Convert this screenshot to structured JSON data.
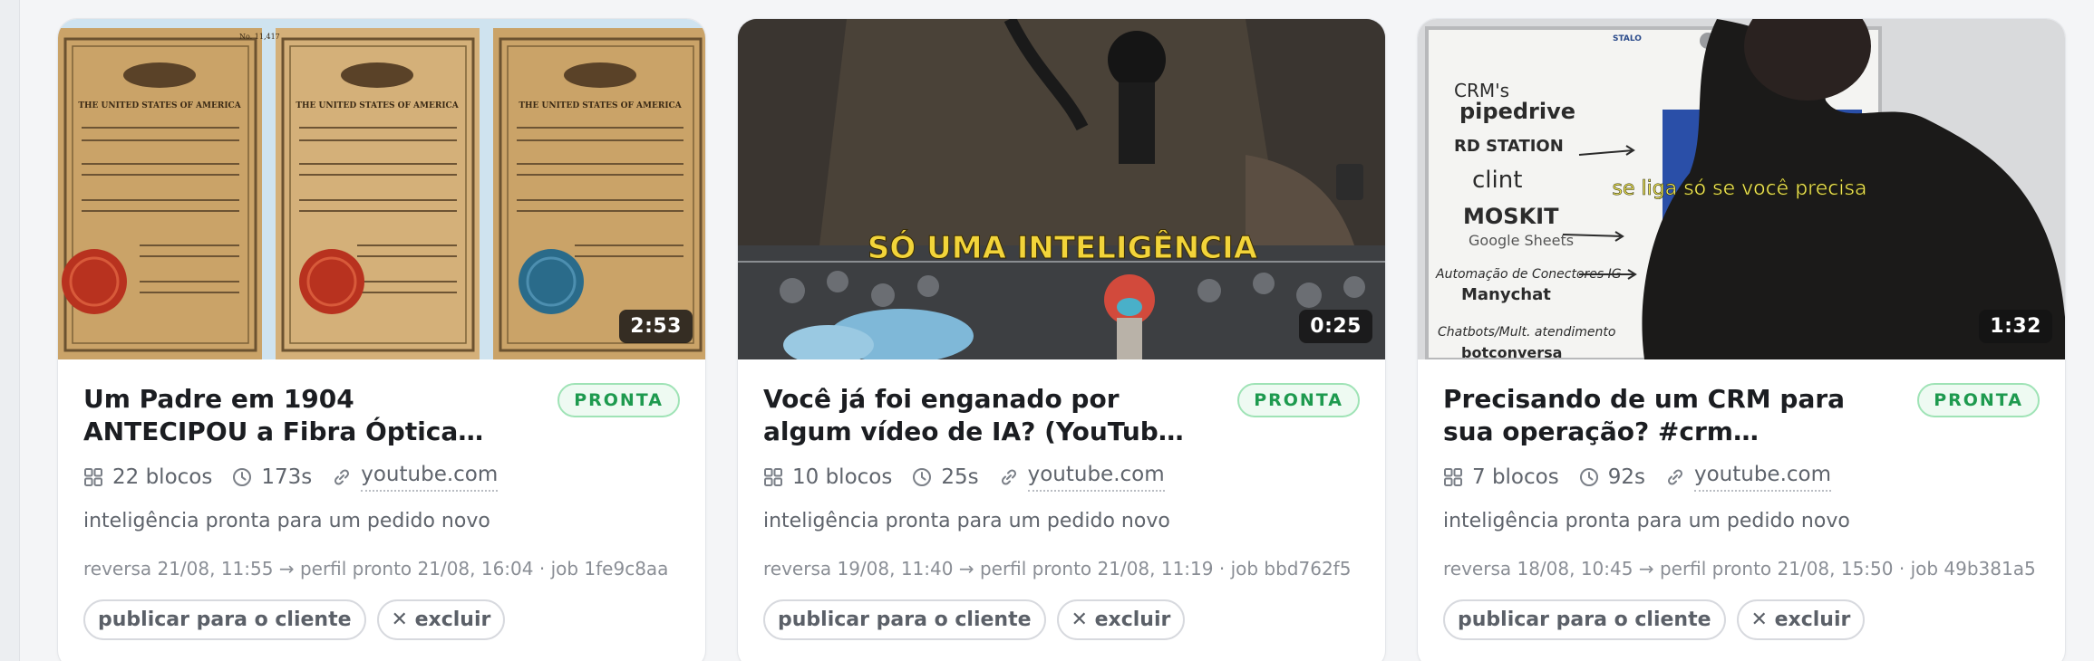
{
  "cards": [
    {
      "title": "Um Padre em 1904\nANTECIPOU a Fibra Óptica…",
      "status": "PRONTA",
      "duration": "2:53",
      "blocks": "22 blocos",
      "seconds": "173s",
      "source": "youtube.com",
      "description": "inteligência pronta para um pedido novo",
      "timeline": "reversa 21/08, 11:55 → perfil pronto 21/08, 16:04 · job 1fe9c8aa",
      "publish_label": "publicar para o cliente",
      "delete_label": "✕ excluir",
      "thumb_header": "THE UNITED STATES OF AMERICA",
      "thumb_number": "No. 11,417"
    },
    {
      "title": "Você já foi enganado por\nalgum vídeo de IA? (YouTub…",
      "status": "PRONTA",
      "duration": "0:25",
      "blocks": "10 blocos",
      "seconds": "25s",
      "source": "youtube.com",
      "description": "inteligência pronta para um pedido novo",
      "timeline": "reversa 19/08, 11:40 → perfil pronto 21/08, 11:19 · job bbd762f5",
      "publish_label": "publicar para o cliente",
      "delete_label": "✕ excluir",
      "thumb_caption": "SÓ UMA INTELIGÊNCIA"
    },
    {
      "title": "Precisando de um CRM para\nsua operação? #crm…",
      "status": "PRONTA",
      "duration": "1:32",
      "blocks": "7 blocos",
      "seconds": "92s",
      "source": "youtube.com",
      "description": "inteligência pronta para um pedido novo",
      "timeline": "reversa 18/08, 10:45 → perfil pronto 21/08, 15:50 · job 49b381a5",
      "publish_label": "publicar para o cliente",
      "delete_label": "✕ excluir",
      "thumb_caption": "se liga só se você precisa",
      "board_lines": [
        "CRM's",
        "pipedrive",
        "RD STATION",
        "clint",
        "MOSKIT",
        "Google Sheets",
        "Automação de Conectores IG",
        "Manychat",
        "Chatbots/Mult. atendimento",
        "botconversa"
      ],
      "board_brand": "STALO"
    }
  ],
  "colors": {
    "status_green": "#1e9a4f",
    "status_border": "#9fe3b6",
    "caption_yellow": "#f2d43a"
  }
}
